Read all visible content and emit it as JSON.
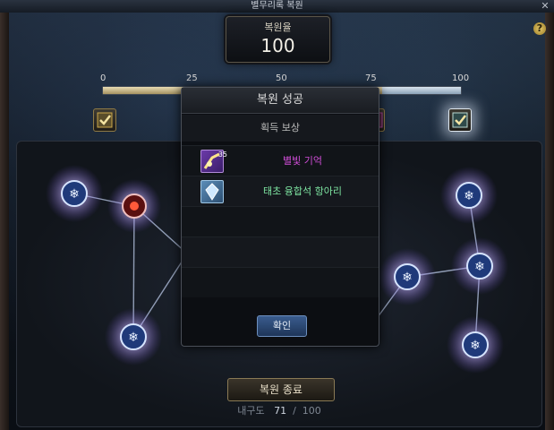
{
  "window": {
    "title": "별무리록 복원"
  },
  "score": {
    "label": "복원율",
    "value": "100"
  },
  "progress": {
    "ticks": [
      "0",
      "25",
      "50",
      "75",
      "100"
    ],
    "fraction": 1.0
  },
  "modal": {
    "title": "복원 성공",
    "subtitle": "획득 보상",
    "items": [
      {
        "count": "35",
        "name": "별빛 기억",
        "icon": "star-memory-icon"
      },
      {
        "count": "",
        "name": "태초 융합석 항아리",
        "icon": "fusion-stone-jar-icon"
      }
    ],
    "confirm_label": "확인"
  },
  "footer": {
    "end_label": "복원 종료",
    "durability_label": "내구도",
    "durability_current": "71",
    "durability_sep": "/",
    "durability_max": "100"
  },
  "colors": {
    "accent_gold": "#8f7a45",
    "confirm_blue": "#3a5c8e",
    "item_purple": "#d14ed8",
    "item_green": "#7ee6a2"
  }
}
